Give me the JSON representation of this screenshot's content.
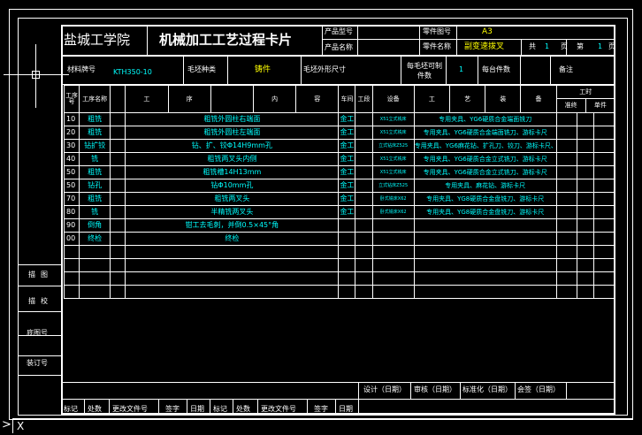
{
  "header": {
    "school": "盐城工学院",
    "card_title": "机械加工工艺过程卡片",
    "product_model_label": "产品型号",
    "product_name_label": "产品名称",
    "part_drawing_no_label": "零件图号",
    "part_drawing_no_value": "A3",
    "part_name_label": "零件名称",
    "part_name_value": "副变速拨叉",
    "total_label": "共",
    "total_value": "1",
    "page_unit_1": "页",
    "page_label": "第",
    "page_value": "1",
    "page_unit_2": "页"
  },
  "material": {
    "material_label": "材料牌号",
    "material_value": "KTH350-10",
    "blank_type_label": "毛坯种类",
    "blank_type_value": "铸件",
    "blank_dims_label": "毛坯外形尺寸",
    "per_blank_label": "每毛坯可制件数",
    "per_blank_value": "1",
    "per_unit_label": "每台件数",
    "notes_label": "备注"
  },
  "columns": {
    "op_no": "工序号",
    "op_name": "工序名称",
    "content_1": "工",
    "content_2": "序",
    "content_3": "内",
    "content_4": "容",
    "workshop": "车间",
    "section": "工段",
    "equipment": "设备",
    "tooling_1": "工",
    "tooling_2": "艺",
    "tooling_3": "装",
    "tooling_4": "备",
    "time": "工时",
    "time_std": "准终",
    "time_unit": "单件"
  },
  "operations": [
    {
      "no": "10",
      "name": "粗铣",
      "content": "粗铣外圆柱右端面",
      "workshop": "金工",
      "equipment": "X51立式铣床",
      "tooling": "专用夹具、YG6硬质合金端面铣刀"
    },
    {
      "no": "20",
      "name": "粗铣",
      "content": "粗铣外圆柱左端面",
      "workshop": "金工",
      "equipment": "X51立式铣床",
      "tooling": "专用夹具、YG6硬质合金端面铣刀、游标卡尺"
    },
    {
      "no": "30",
      "name": "钻扩铰",
      "content": "钻、扩、铰Φ14H9mm孔",
      "workshop": "金工",
      "equipment": "立式钻床Z525",
      "tooling": "专用夹具、YG6麻花钻、扩孔刀、铰刀、游标卡尺、内径量规"
    },
    {
      "no": "40",
      "name": "铣",
      "content": "粗铣两叉头内侧",
      "workshop": "金工",
      "equipment": "X51立式铣床",
      "tooling": "专用夹具、YG6硬质合金立式铣刀、游标卡尺"
    },
    {
      "no": "50",
      "name": "粗铣",
      "content": "粗铣槽14H13mm",
      "workshop": "金工",
      "equipment": "X51立式铣床",
      "tooling": "专用夹具、YG6硬质合金立式铣刀、游标卡尺"
    },
    {
      "no": "50",
      "name": "钻孔",
      "content": "钻Φ10mm孔",
      "workshop": "金工",
      "equipment": "立式钻床Z525",
      "tooling": "专用夹具、麻花钻、游标卡尺"
    },
    {
      "no": "70",
      "name": "粗铣",
      "content": "粗铣两叉头",
      "workshop": "金工",
      "equipment": "卧式铣床X62",
      "tooling": "专用夹具、YG8硬质合金盘铣刀、游标卡尺"
    },
    {
      "no": "80",
      "name": "铣",
      "content": "半精铣两叉头",
      "workshop": "金工",
      "equipment": "卧式铣床X62",
      "tooling": "专用夹具、YG8硬质合金盘铣刀、游标卡尺"
    },
    {
      "no": "90",
      "name": "倒角",
      "content": "钳工去毛刺，并倒0.5×45°角",
      "workshop": "",
      "equipment": "",
      "tooling": ""
    },
    {
      "no": "00",
      "name": "终检",
      "content": "终检",
      "workshop": "",
      "equipment": "",
      "tooling": ""
    }
  ],
  "side_labels": {
    "trace": "描图",
    "proof": "描校",
    "base_no": "底图号",
    "binding_no": "装订号"
  },
  "footer": {
    "design": "设计（日期）",
    "review": "审核（日期）",
    "standard": "标准化（日期）",
    "sign": "会签（日期）",
    "mark": "标记",
    "count": "处数",
    "change_doc": "更改文件号",
    "signature": "签字",
    "date": "日期",
    "mark2": "标记",
    "count2": "处数",
    "change_doc2": "更改文件号",
    "signature2": "签字",
    "date2": "日期"
  },
  "command_line": {
    "prompt": "X"
  },
  "colors": {
    "background": "#000000",
    "lines": "#ffffff",
    "data_text": "#00ffff",
    "value_text": "#ffff00"
  }
}
